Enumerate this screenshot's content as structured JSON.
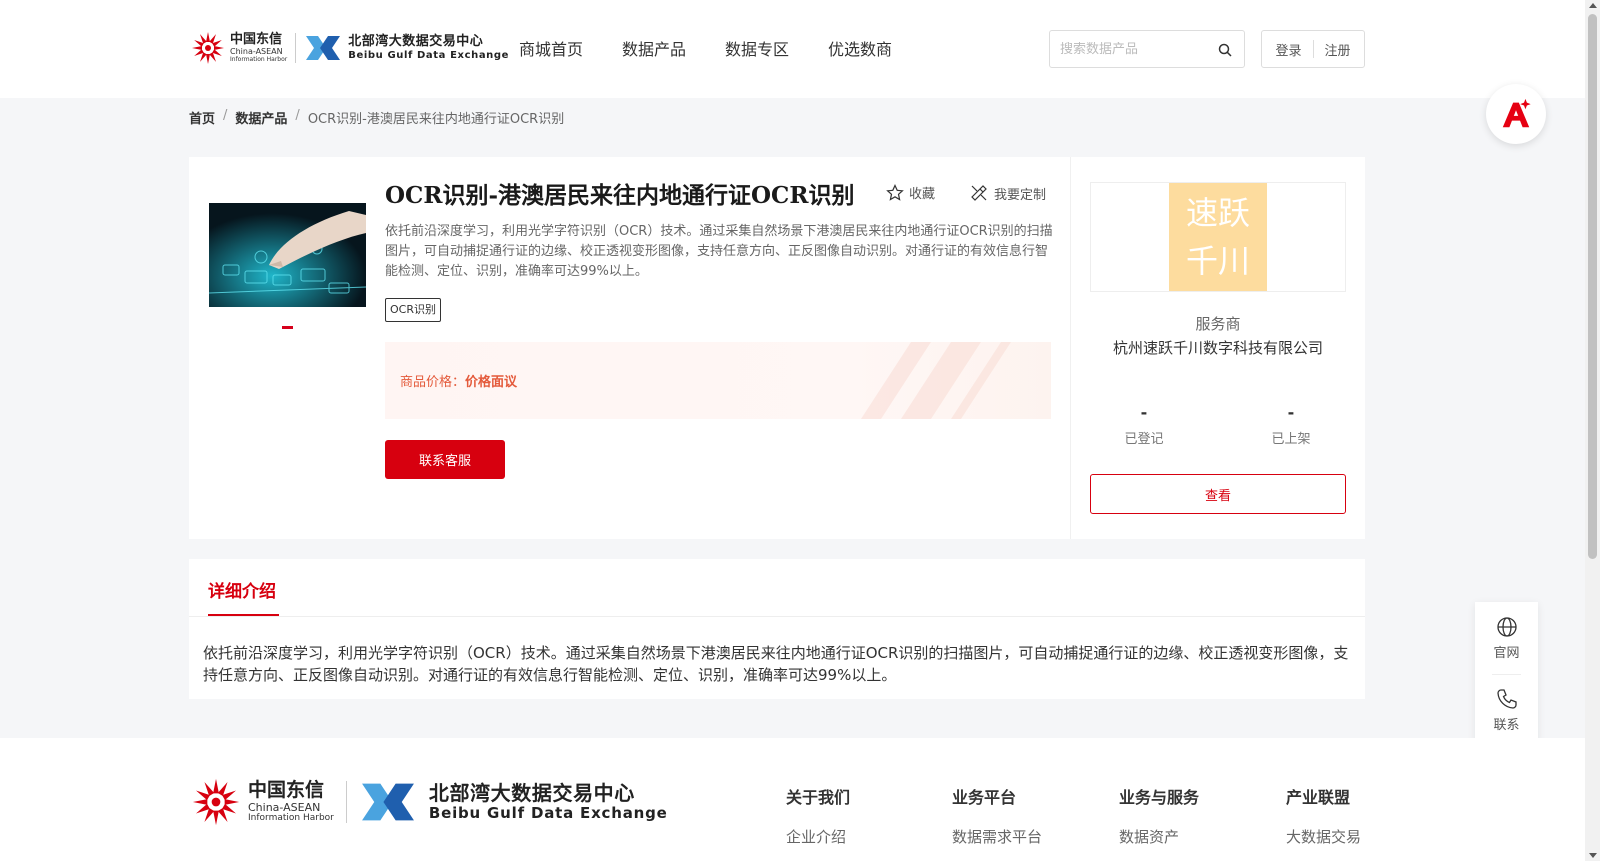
{
  "header": {
    "logo": {
      "brand1_cn": "中国东信",
      "brand1_en1": "China-ASEAN",
      "brand1_en2": "Information Harbor",
      "brand2_cn": "北部湾大数据交易中心",
      "brand2_en": "Beibu Gulf Data Exchange"
    },
    "nav": [
      "商城首页",
      "数据产品",
      "数据专区",
      "优选数商"
    ],
    "search": {
      "placeholder": "搜索数据产品",
      "value": ""
    },
    "login": "登录",
    "register": "注册"
  },
  "breadcrumb": {
    "items": [
      "首页",
      "数据产品"
    ],
    "current": "OCR识别-港澳居民来往内地通行证OCR识别",
    "separator": "/"
  },
  "product": {
    "title": "OCR识别-港澳居民来往内地通行证OCR识别",
    "favorite_label": "收藏",
    "custom_label": "我要定制",
    "description": "依托前沿深度学习，利用光学字符识别（OCR）技术。通过采集自然场景下港澳居民来往内地通行证OCR识别的扫描图片，可自动捕捉通行证的边缘、校正透视变形图像，支持任意方向、正反图像自动识别。对通行证的有效信息行智能检测、定位、识别，准确率可达99%以上。",
    "tag": "OCR识别",
    "price_label": "商品价格：",
    "price_value": "价格面议",
    "contact_button": "联系客服"
  },
  "provider": {
    "logo_line1": "速跃",
    "logo_line2": "千川",
    "label": "服务商",
    "name": "杭州速跃千川数字科技有限公司",
    "stats": [
      {
        "value": "-",
        "label": "已登记"
      },
      {
        "value": "-",
        "label": "已上架"
      }
    ],
    "view_button": "查看"
  },
  "detail": {
    "tab": "详细介绍",
    "text": "依托前沿深度学习，利用光学字符识别（OCR）技术。通过采集自然场景下港澳居民来往内地通行证OCR识别的扫描图片，可自动捕捉通行证的边缘、校正透视变形图像，支持任意方向、正反图像自动识别。对通行证的有效信息行智能检测、定位、识别，准确率可达99%以上。"
  },
  "float_side": {
    "website": "官网",
    "contact": "联系"
  },
  "footer": {
    "columns": [
      {
        "title": "关于我们",
        "first": "企业介绍"
      },
      {
        "title": "业务平台",
        "first": "数据需求平台"
      },
      {
        "title": "业务与服务",
        "first": "数据资产"
      },
      {
        "title": "产业联盟",
        "first": "大数据交易"
      }
    ]
  },
  "colors": {
    "brand_red": "#d7000f",
    "price_orange": "#e45a3b",
    "provider_tile": "#fddc9e",
    "page_bg": "#f5f6f8"
  }
}
